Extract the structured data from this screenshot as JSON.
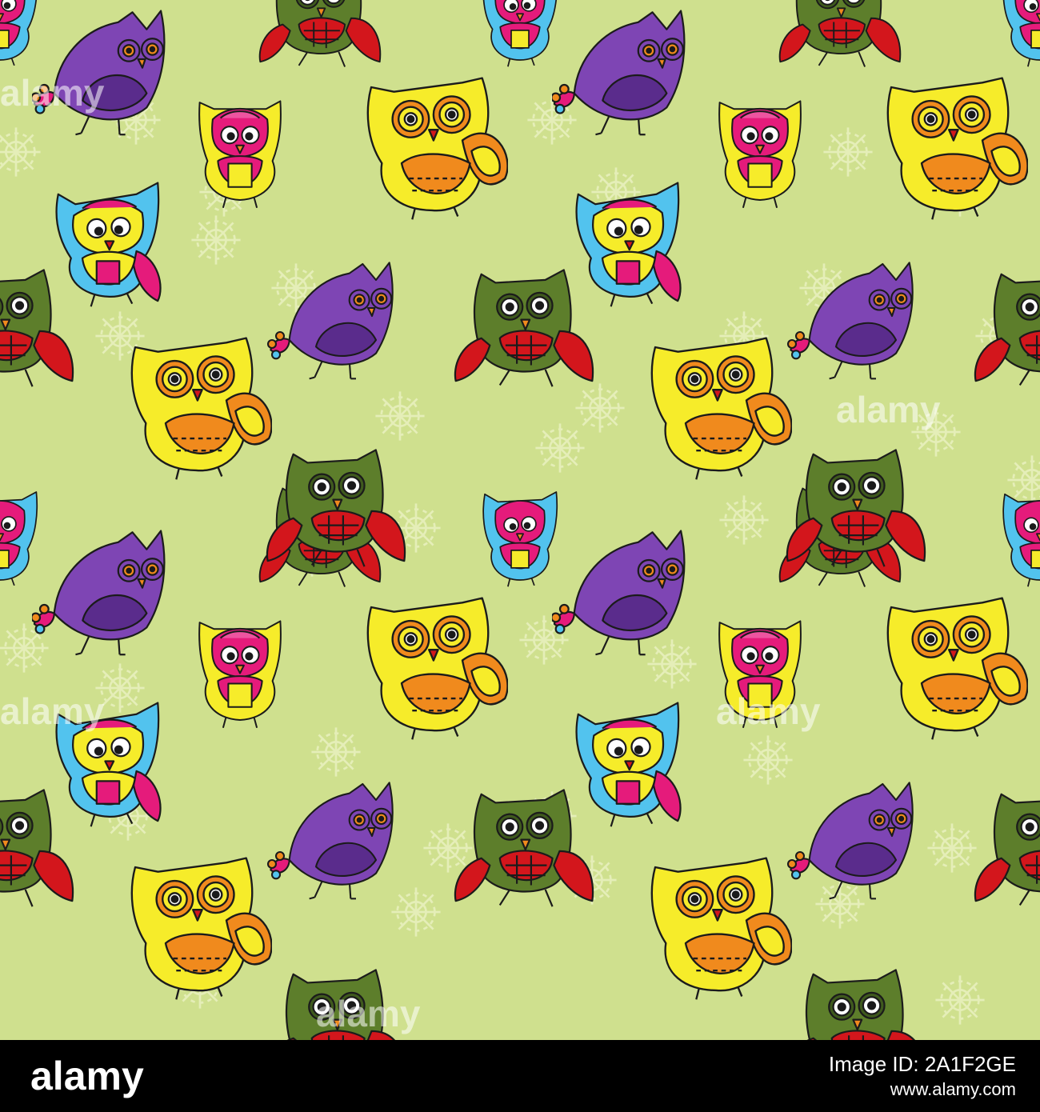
{
  "artwork": {
    "background_color": "#cfe08e",
    "owl_kinds": [
      "purple-owl",
      "pink-owl",
      "ornate-yellow-owl",
      "blue-pink-owl",
      "green-owl",
      "blue-yellow-owl"
    ],
    "colors": {
      "purple": "#7e45b4",
      "pink": "#e51b7b",
      "yellow": "#f6ec2a",
      "orange": "#f08a1d",
      "blue": "#52c3ee",
      "green": "#5d7e2b",
      "red": "#d3161c",
      "outline": "#1b1b1b",
      "snowflake": "#e7efbe"
    }
  },
  "watermark": {
    "text": "alamy"
  },
  "footer": {
    "logo_text": "alamy",
    "image_id": "Image ID: 2A1F2GE",
    "url": "www.alamy.com"
  }
}
